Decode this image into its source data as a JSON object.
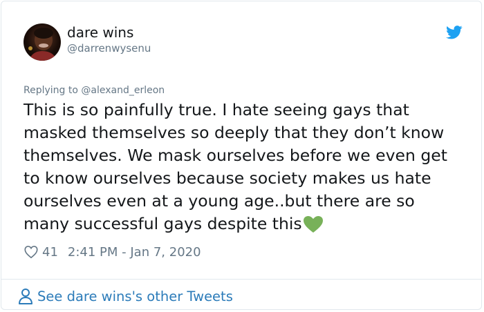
{
  "tweet": {
    "author": {
      "display_name": "dare wins",
      "screen_name": "@darrenwysenu"
    },
    "replying_to": "Replying to @alexand_erleon",
    "text": "This is so painfully true. I hate seeing gays that\nmasked themselves so deeply that they don’t know\nthemselves. We mask ourselves before we even get\nto know ourselves because society makes us hate\nourselves even at a young age..but there are so\nmany successful gays despite this",
    "trailing_emoji": "green-heart-emoji",
    "like_count": "41",
    "timestamp": "2:41 PM - Jan 7, 2020"
  },
  "footer": {
    "see_more_label": "See dare wins's other Tweets"
  },
  "icons": {
    "logo": "twitter-bird-icon",
    "like": "heart-outline-icon",
    "person": "person-icon"
  },
  "colors": {
    "twitter_blue": "#1da1f2",
    "link_blue": "#2b7bb9",
    "text_primary": "#14171a",
    "text_secondary": "#657786",
    "border": "#e1e8ed",
    "green_heart": "#78b159"
  }
}
